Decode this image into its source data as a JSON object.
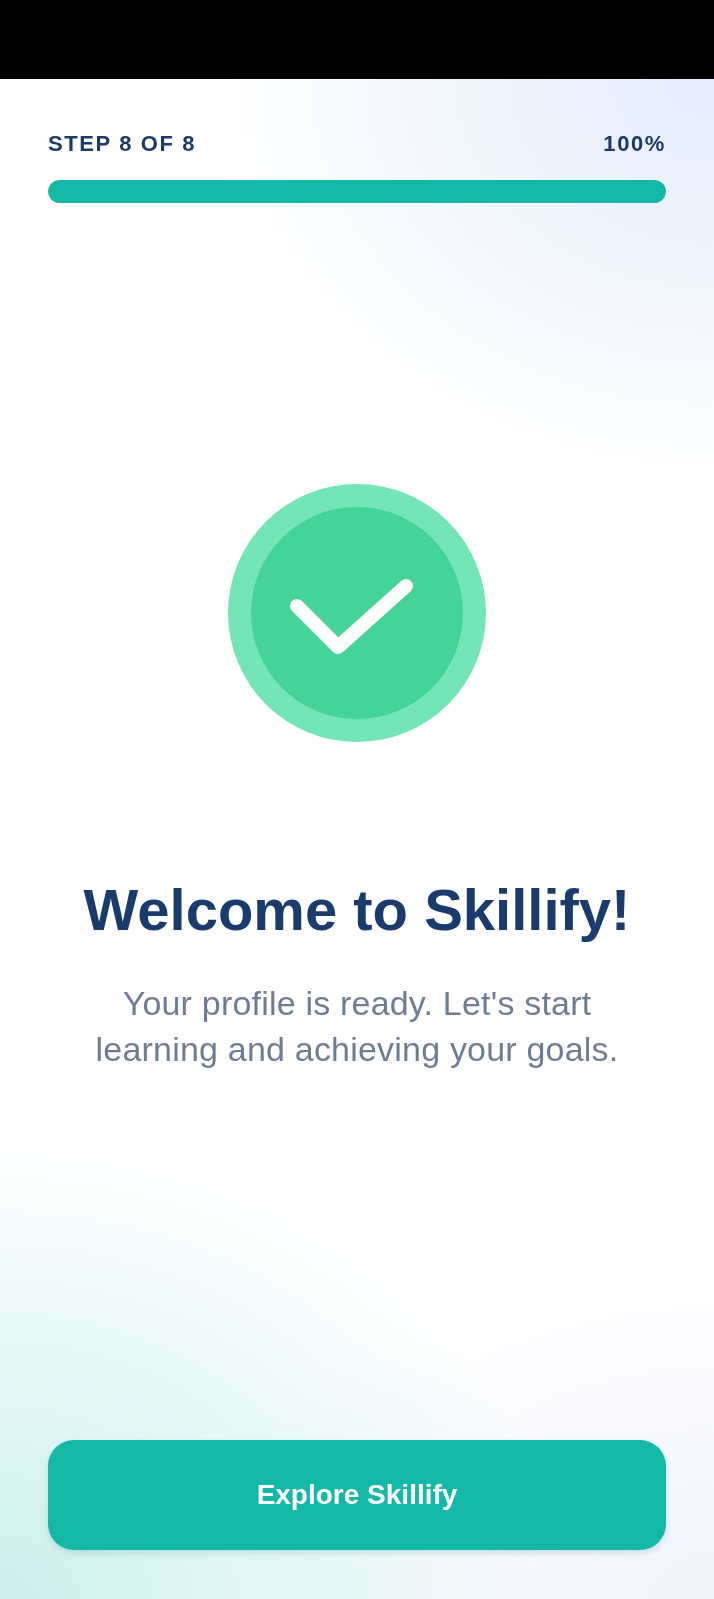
{
  "progress": {
    "step_label": "STEP 8 OF 8",
    "percent": "100%",
    "level": 1
  },
  "title": "Welcome to Skillify!",
  "message": "Your profile is ready. Let's start learning and achieving your goals.",
  "primary_button": {
    "label": "Explore Skillify"
  }
}
